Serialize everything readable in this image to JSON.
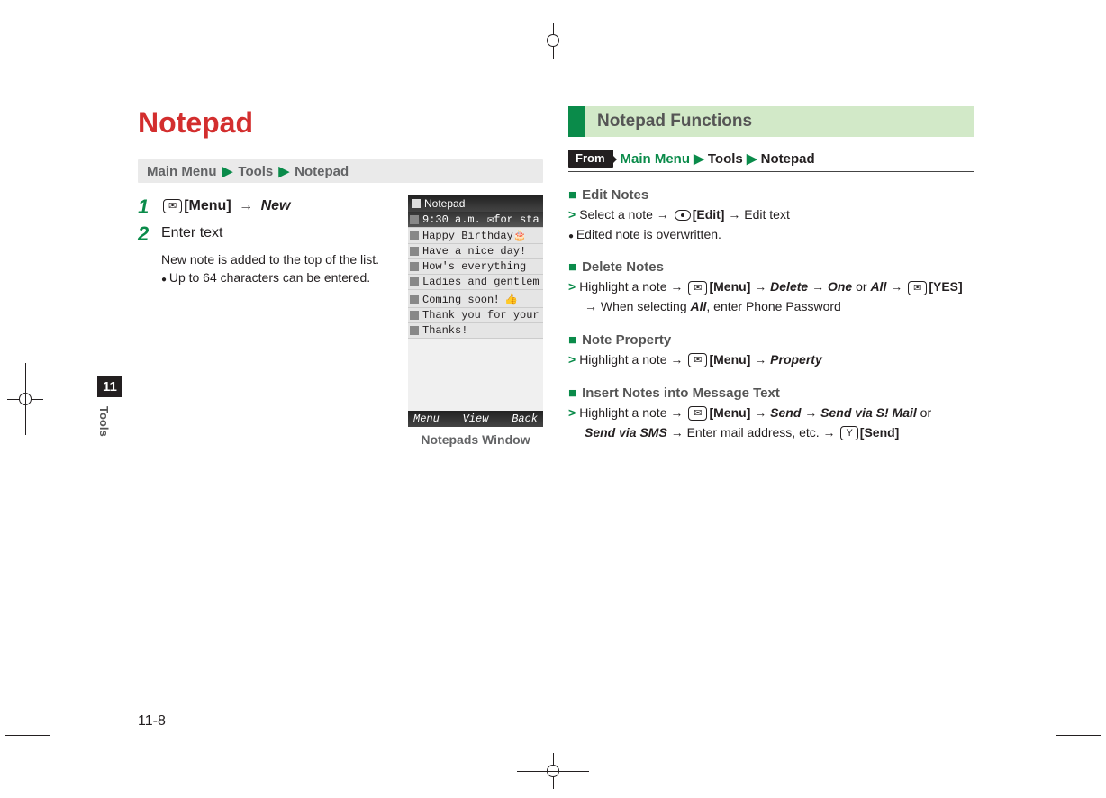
{
  "sidetab": {
    "chapter": "11",
    "label": "Tools"
  },
  "page_number": "11-8",
  "left": {
    "title": "Notepad",
    "breadcrumb": [
      "Main Menu",
      "Tools",
      "Notepad"
    ],
    "step1": {
      "num": "1",
      "key_label": "✉",
      "after_key": "[Menu]",
      "arrow_to": "New"
    },
    "step2": {
      "num": "2",
      "text": "Enter text"
    },
    "sub_line": "New note is added to the top of the list.",
    "sub_bullet": "Up to 64 characters can be entered.",
    "phone": {
      "header": "Notepad",
      "rows": [
        "9:30 a.m. ✉for sta",
        "Happy Birthday🎂",
        "Have a nice day!",
        "How's everything",
        "Ladies and gentlem",
        "Coming soon！👍",
        "Thank you for your",
        "Thanks!"
      ],
      "softkeys": [
        "Menu",
        "View",
        "Back"
      ],
      "caption": "Notepads Window"
    }
  },
  "right": {
    "section_title": "Notepad Functions",
    "from_label": "From",
    "from_path": [
      "Main Menu",
      "Tools",
      "Notepad"
    ],
    "funcs": {
      "edit": {
        "title": "Edit Notes",
        "line": "Select a note → ",
        "key_label": "[Edit]",
        "after": " → Edit text",
        "bullet": "Edited note is overwritten."
      },
      "delete": {
        "title": "Delete Notes",
        "prefix": "Highlight a note → ",
        "menu": "[Menu]",
        "del": "Delete",
        "one": "One",
        "or": " or ",
        "all": "All",
        "yes": "[YES]",
        "line2_prefix": "→ When selecting ",
        "line2_all": "All",
        "line2_suffix": ", enter Phone Password"
      },
      "property": {
        "title": "Note Property",
        "prefix": "Highlight a note → ",
        "menu": "[Menu]",
        "prop": "Property"
      },
      "insert": {
        "title": "Insert Notes into Message Text",
        "prefix": "Highlight a note → ",
        "menu": "[Menu]",
        "send": "Send",
        "via_smail": "Send via S! Mail",
        "or": " or",
        "via_sms": "Send via SMS",
        "suffix": " → Enter mail address, etc. → ",
        "send_key": "[Send]"
      }
    }
  }
}
